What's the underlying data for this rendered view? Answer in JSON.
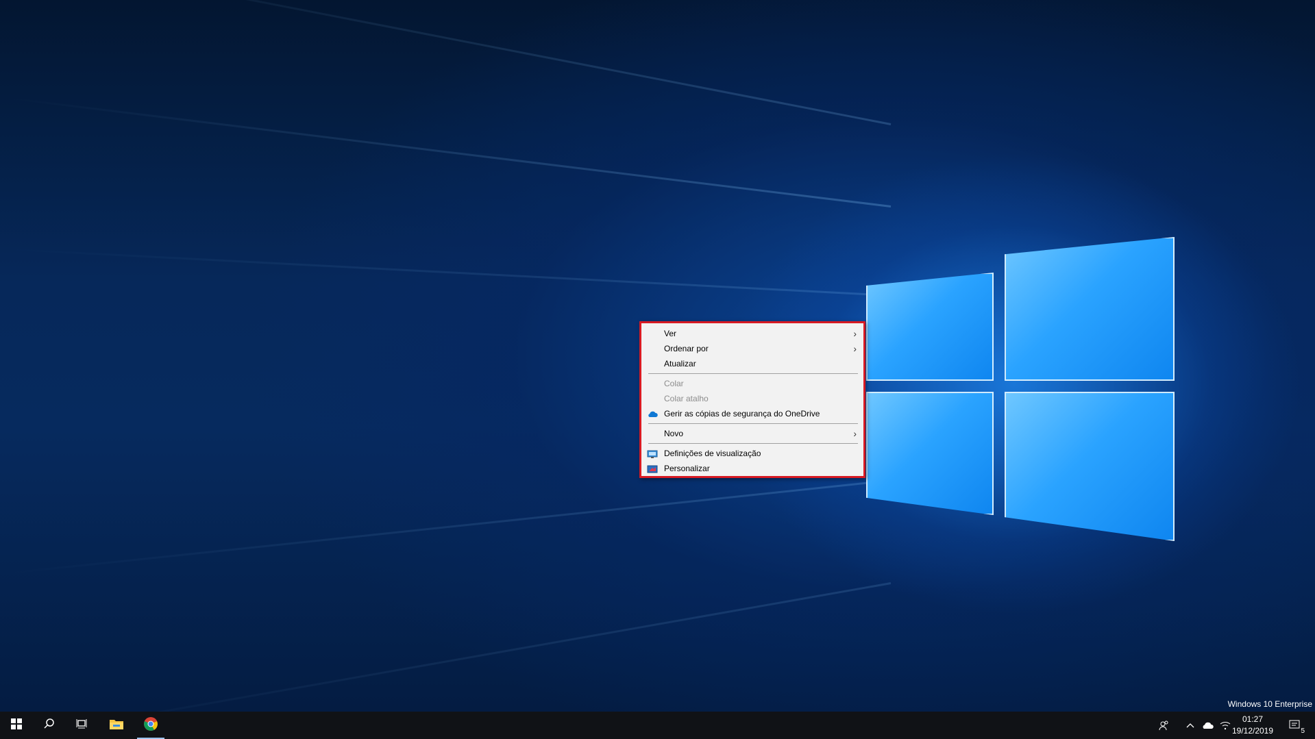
{
  "desktop": {
    "watermark": "Windows 10 Enterprise"
  },
  "context_menu": {
    "items": [
      {
        "label": "Ver",
        "submenu": true,
        "disabled": false
      },
      {
        "label": "Ordenar por",
        "submenu": true,
        "disabled": false
      },
      {
        "label": "Atualizar",
        "submenu": false,
        "disabled": false
      },
      {
        "label": "Colar",
        "submenu": false,
        "disabled": true
      },
      {
        "label": "Colar atalho",
        "submenu": false,
        "disabled": true
      },
      {
        "label": "Gerir as cópias de segurança do OneDrive",
        "submenu": false,
        "disabled": false,
        "icon": "onedrive-icon"
      },
      {
        "label": "Novo",
        "submenu": true,
        "disabled": false
      },
      {
        "label": "Definições de visualização",
        "submenu": false,
        "disabled": false,
        "icon": "display-settings-icon"
      },
      {
        "label": "Personalizar",
        "submenu": false,
        "disabled": false,
        "icon": "personalize-icon"
      }
    ],
    "border_color": "#d71a23"
  },
  "taskbar": {
    "apps": [
      "start-icon",
      "search-icon",
      "task-view-icon",
      "file-explorer-icon",
      "chrome-icon"
    ],
    "tray": {
      "time": "01:27",
      "date": "19/12/2019",
      "notification_count": "5"
    }
  }
}
